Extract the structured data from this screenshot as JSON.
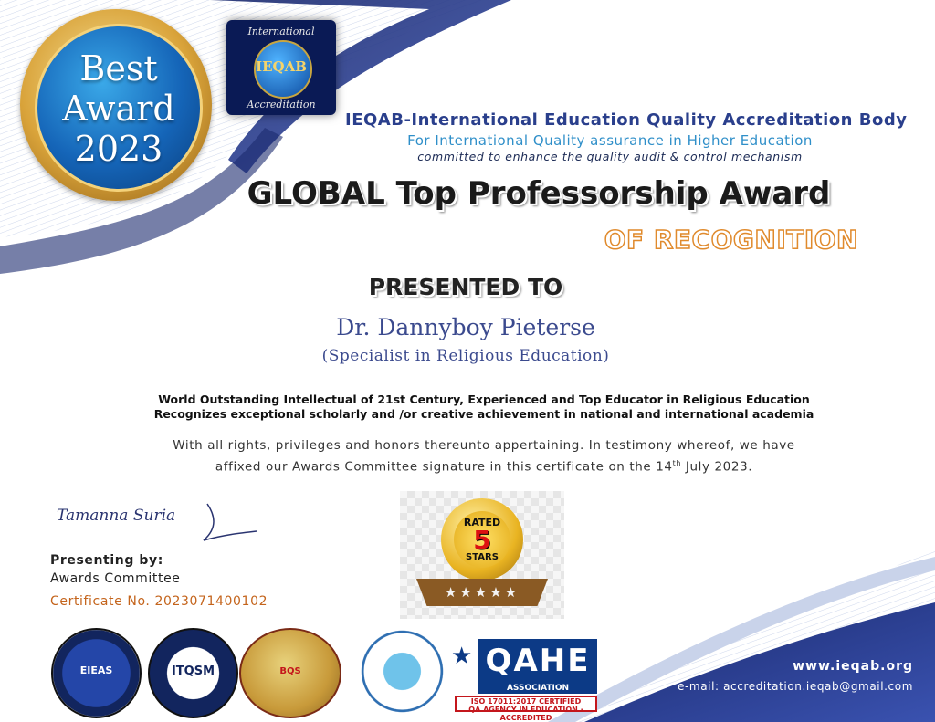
{
  "medal": {
    "line1": "Best",
    "line2": "Award",
    "line3": "2023"
  },
  "logo": {
    "top_text": "International",
    "abbr": "IEQAB",
    "bottom_text": "Accreditation"
  },
  "org": {
    "name": "IEQAB-International Education Quality Accreditation Body",
    "tagline": "For International Quality assurance in Higher Education",
    "mission": "committed to enhance the quality audit & control mechanism"
  },
  "award": {
    "title": "GLOBAL Top Professorship Award",
    "subtitle": "OF RECOGNITION"
  },
  "presented": {
    "label": "PRESENTED TO",
    "recipient": "Dr. Dannyboy Pieterse",
    "specialty": "(Specialist in Religious Education)"
  },
  "citation": {
    "line1": "World Outstanding Intellectual of 21st Century, Experienced and Top Educator in Religious Education",
    "line2": "Recognizes exceptional scholarly and /or creative achievement in national and international academia"
  },
  "body": {
    "line1": "With all rights, privileges and honors thereunto appertaining. In testimony whereof, we have",
    "line2_pre": "affixed our Awards Committee signature in this certificate on the 14",
    "line2_sup": "th",
    "line2_post": " July 2023."
  },
  "signature": {
    "name": "Tamanna Suria"
  },
  "presenting": {
    "label": "Presenting by:",
    "value": "Awards Committee"
  },
  "certificate": {
    "label": "Certificate No.",
    "number": "2023071400102"
  },
  "rated_seal": {
    "top": "RATED",
    "number": "5",
    "bottom": "STARS",
    "stars": "★★★★★"
  },
  "badges": {
    "eieas": "EIEAS",
    "itqsm": "ITQSM",
    "bqs": "BQS",
    "qahe_main": "QAHE",
    "qahe_sub": "ASSOCIATION",
    "qahe_iso1": "ISO 17011:2017 CERTIFIED",
    "qahe_iso2": "QA AGENCY IN EDUCATION · ACCREDITED"
  },
  "footer": {
    "website": "www.ieqab.org",
    "email": "e-mail: accreditation.ieqab@gmail.com"
  },
  "colors": {
    "navy": "#1b2a6e",
    "accent_blue": "#2f8fc9",
    "orange": "#e08a2c",
    "gold": "#d9a33a"
  }
}
